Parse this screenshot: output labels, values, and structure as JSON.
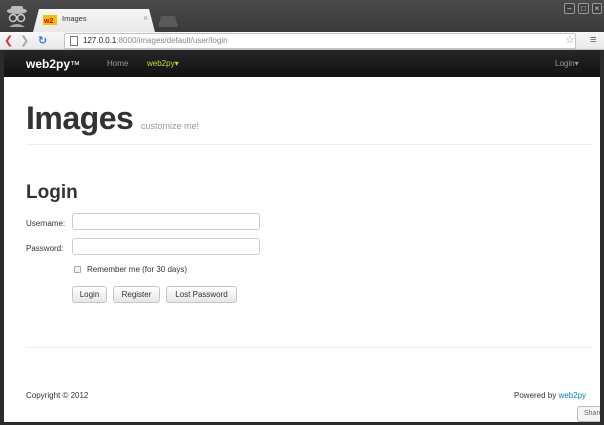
{
  "browser": {
    "tab_title": "Images",
    "url_host": "127.0.0.1",
    "url_path": ":8000/images/default/user/login"
  },
  "navbar": {
    "brand": "web2py",
    "brand_tm": "™",
    "home": "Home",
    "app_menu": "web2py",
    "login_menu": "Login"
  },
  "hero": {
    "title": "Images",
    "subtitle": "customize me!"
  },
  "form": {
    "heading": "Login",
    "username_label": "Username:",
    "password_label": "Password:",
    "username_value": "",
    "password_value": "",
    "remember_label": "Remember me (for 30 days)",
    "remember_checked": false,
    "login_button": "Login",
    "register_button": "Register",
    "lost_password_button": "Lost Password"
  },
  "footer": {
    "copyright": "Copyright © 2012",
    "powered_prefix": "Powered by ",
    "powered_link": "web2py",
    "share": "Share"
  },
  "colors": {
    "navbar_bg": "#1b1b1b",
    "app_menu_accent": "#c7d944",
    "link": "#0088cc"
  },
  "icons": [
    "incognito-icon",
    "favicon-icon",
    "close-tab-icon",
    "back-icon",
    "forward-icon",
    "reload-icon",
    "page-icon",
    "bookmark-star-icon",
    "menu-icon",
    "caret-down-icon"
  ]
}
